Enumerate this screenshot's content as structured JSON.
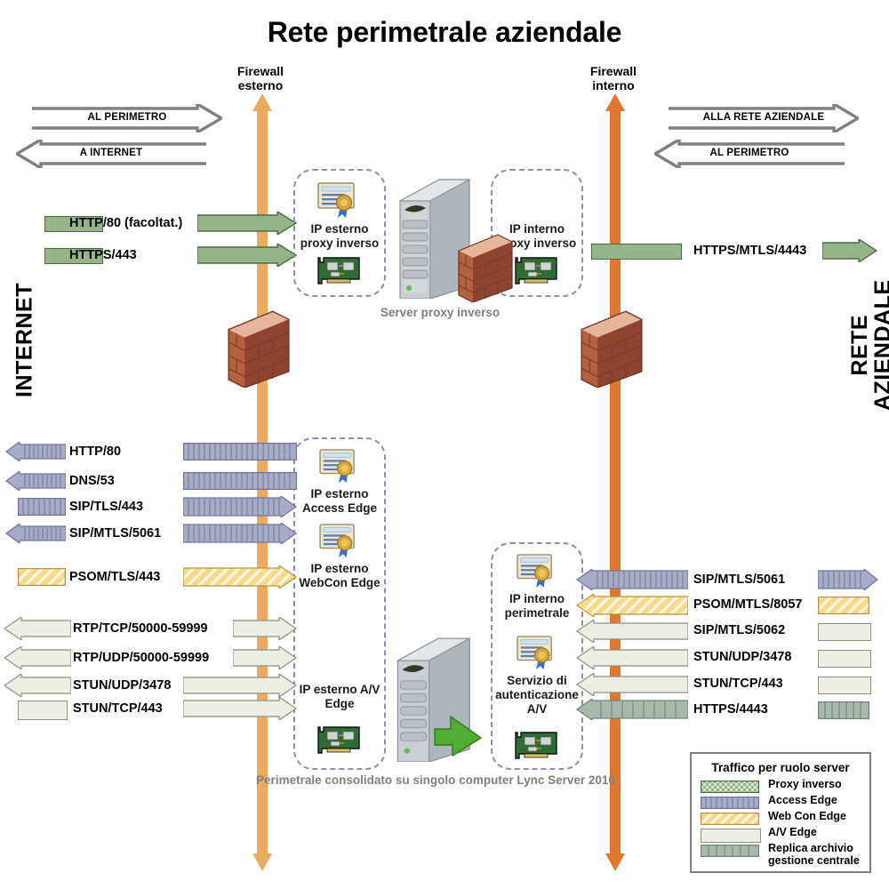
{
  "title": "Rete perimetrale aziendale",
  "side_labels": {
    "left": "INTERNET",
    "right": "RETE\nAZIENDALE"
  },
  "firewalls": [
    {
      "name": "firewall-esterno",
      "label": "Firewall\nesterno",
      "color": "#e8ab62"
    },
    {
      "name": "firewall-interno",
      "label": "Firewall\ninterno",
      "color": "#e0762f"
    }
  ],
  "direction_arrows": [
    {
      "name": "al-perimetro-left",
      "label": "AL PERIMETRO",
      "direction": "right"
    },
    {
      "name": "a-internet-left",
      "label": "A INTERNET",
      "direction": "left"
    },
    {
      "name": "alla-rete-right",
      "label": "ALLA RETE AZIENDALE",
      "direction": "right"
    },
    {
      "name": "al-perimetro-right",
      "label": "AL PERIMETRO",
      "direction": "left"
    }
  ],
  "zones": [
    {
      "name": "ip-esterno-proxy-inverso",
      "label": "IP esterno\nproxy inverso"
    },
    {
      "name": "ip-interno-proxy-inverso",
      "label": "IP interno\nproxy inverso"
    },
    {
      "name": "edge-esterno",
      "labels": [
        "IP esterno\nAccess Edge",
        "IP esterno\nWebCon Edge",
        "IP esterno A/V\nEdge"
      ]
    },
    {
      "name": "edge-interno",
      "labels": [
        "IP interno\nperimetrale",
        "Servizio di\nautenticazione\nA/V"
      ]
    }
  ],
  "captions": {
    "reverse_proxy_server": "Server proxy inverso",
    "edge_server": "Perimetrale consolidato su singolo computer Lync Server 2010"
  },
  "proxy_rows": [
    {
      "name": "http-80-facoltat",
      "label": "HTTP/80 (facoltat.)",
      "role": "proxy",
      "direction": "right"
    },
    {
      "name": "https-443",
      "label": "HTTPS/443",
      "role": "proxy",
      "direction": "right"
    }
  ],
  "proxy_rows_right": [
    {
      "name": "https-mtls-4443",
      "label": "HTTPS/MTLS/4443",
      "role": "proxy",
      "direction": "right"
    }
  ],
  "left_rows": [
    {
      "name": "http-80",
      "label": "HTTP/80",
      "role": "access",
      "direction": "left"
    },
    {
      "name": "dns-53",
      "label": "DNS/53",
      "role": "access",
      "direction": "left"
    },
    {
      "name": "sip-tls-443",
      "label": "SIP/TLS/443",
      "role": "access",
      "direction": "right"
    },
    {
      "name": "sip-mtls-5061",
      "label": "SIP/MTLS/5061",
      "role": "access",
      "direction": "both"
    },
    {
      "name": "psom-tls-443",
      "label": "PSOM/TLS/443",
      "role": "webcon",
      "direction": "right"
    },
    {
      "name": "rtp-tcp-50000-59999",
      "label": "RTP/TCP/50000-59999",
      "role": "av",
      "direction": "both"
    },
    {
      "name": "rtp-udp-50000-59999",
      "label": "RTP/UDP/50000-59999",
      "role": "av",
      "direction": "both"
    },
    {
      "name": "stun-udp-3478",
      "label": "STUN/UDP/3478",
      "role": "av",
      "direction": "both"
    },
    {
      "name": "stun-tcp-443",
      "label": "STUN/TCP/443",
      "role": "av",
      "direction": "right"
    }
  ],
  "right_rows": [
    {
      "name": "sip-mtls-5061-r",
      "label": "SIP/MTLS/5061",
      "role": "access",
      "direction": "both"
    },
    {
      "name": "psom-mtls-8057",
      "label": "PSOM/MTLS/8057",
      "role": "webcon",
      "direction": "left"
    },
    {
      "name": "sip-mtls-5062",
      "label": "SIP/MTLS/5062",
      "role": "av",
      "direction": "left"
    },
    {
      "name": "stun-udp-3478-r",
      "label": "STUN/UDP/3478",
      "role": "av",
      "direction": "left"
    },
    {
      "name": "stun-tcp-443-r",
      "label": "STUN/TCP/443",
      "role": "av",
      "direction": "left"
    },
    {
      "name": "https-4443",
      "label": "HTTPS/4443",
      "role": "repl",
      "direction": "left"
    }
  ],
  "legend": {
    "title": "Traffico per ruolo server",
    "items": [
      {
        "name": "proxy-inverso",
        "label": "Proxy inverso",
        "color": "#95b48a"
      },
      {
        "name": "access-edge",
        "label": "Access Edge",
        "color": "#a7abc6"
      },
      {
        "name": "web-con-edge",
        "label": "Web Con Edge",
        "color": "#f5d98a"
      },
      {
        "name": "av-edge",
        "label": "A/V Edge",
        "color": "#edeee3"
      },
      {
        "name": "replica",
        "label": "Replica archivio\ngestione centrale",
        "color": "#a7b9ab"
      }
    ]
  }
}
